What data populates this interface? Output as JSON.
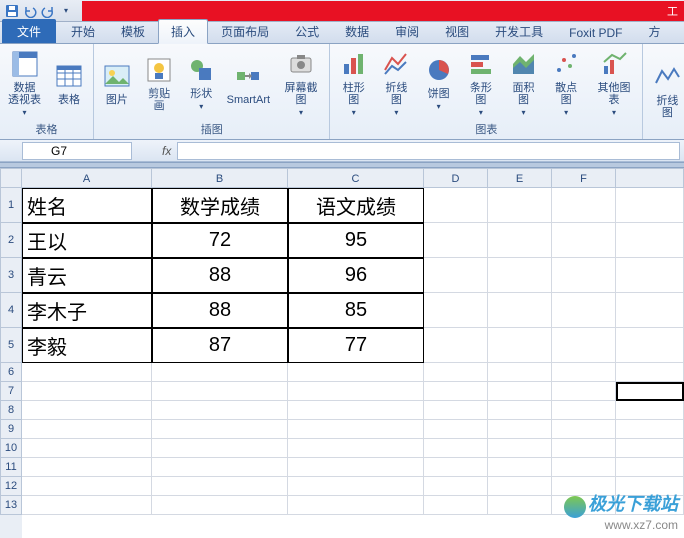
{
  "qat": {
    "dropdown": "▾"
  },
  "titlebar": {
    "right_text": "工"
  },
  "tabs": {
    "file": "文件",
    "items": [
      "开始",
      "模板",
      "插入",
      "页面布局",
      "公式",
      "数据",
      "审阅",
      "视图",
      "开发工具",
      "Foxit PDF",
      "方"
    ],
    "active_index": 2
  },
  "ribbon": {
    "groups": [
      {
        "label": "表格",
        "buttons": [
          {
            "name": "pivot",
            "label": "数据\n透视表",
            "dropdown": true
          },
          {
            "name": "table",
            "label": "表格"
          }
        ]
      },
      {
        "label": "插图",
        "buttons": [
          {
            "name": "picture",
            "label": "图片"
          },
          {
            "name": "clipart",
            "label": "剪贴画"
          },
          {
            "name": "shapes",
            "label": "形状",
            "dropdown": true
          },
          {
            "name": "smartart",
            "label": "SmartArt"
          },
          {
            "name": "screenshot",
            "label": "屏幕截图",
            "dropdown": true
          }
        ]
      },
      {
        "label": "图表",
        "buttons": [
          {
            "name": "column-chart",
            "label": "柱形图",
            "dropdown": true
          },
          {
            "name": "line-chart",
            "label": "折线图",
            "dropdown": true
          },
          {
            "name": "pie-chart",
            "label": "饼图",
            "dropdown": true
          },
          {
            "name": "bar-chart",
            "label": "条形图",
            "dropdown": true
          },
          {
            "name": "area-chart",
            "label": "面积图",
            "dropdown": true
          },
          {
            "name": "scatter-chart",
            "label": "散点图",
            "dropdown": true
          },
          {
            "name": "other-chart",
            "label": "其他图表",
            "dropdown": true
          }
        ]
      },
      {
        "label": "",
        "buttons": [
          {
            "name": "sparkline",
            "label": "折线图"
          }
        ]
      }
    ]
  },
  "namebox": {
    "cell_ref": "G7",
    "fx": "fx",
    "formula": ""
  },
  "columns": [
    "A",
    "B",
    "C",
    "D",
    "E",
    "F"
  ],
  "row_numbers": [
    "1",
    "2",
    "3",
    "4",
    "5",
    "6",
    "7",
    "8",
    "9",
    "10",
    "11",
    "12",
    "13"
  ],
  "data": {
    "headers": [
      "姓名",
      "数学成绩",
      "语文成绩"
    ],
    "rows": [
      {
        "name": "王以",
        "math": "72",
        "chinese": "95"
      },
      {
        "name": "青云",
        "math": "88",
        "chinese": "96"
      },
      {
        "name": "李木子",
        "math": "88",
        "chinese": "85"
      },
      {
        "name": "李毅",
        "math": "87",
        "chinese": "77"
      }
    ]
  },
  "chart_data": {
    "type": "table",
    "title": "",
    "columns": [
      "姓名",
      "数学成绩",
      "语文成绩"
    ],
    "rows": [
      [
        "王以",
        72,
        95
      ],
      [
        "青云",
        88,
        96
      ],
      [
        "李木子",
        88,
        85
      ],
      [
        "李毅",
        87,
        77
      ]
    ]
  },
  "watermark": {
    "line1": "极光下载站",
    "line2": "www.xz7.com"
  },
  "selected_cell": "G7"
}
